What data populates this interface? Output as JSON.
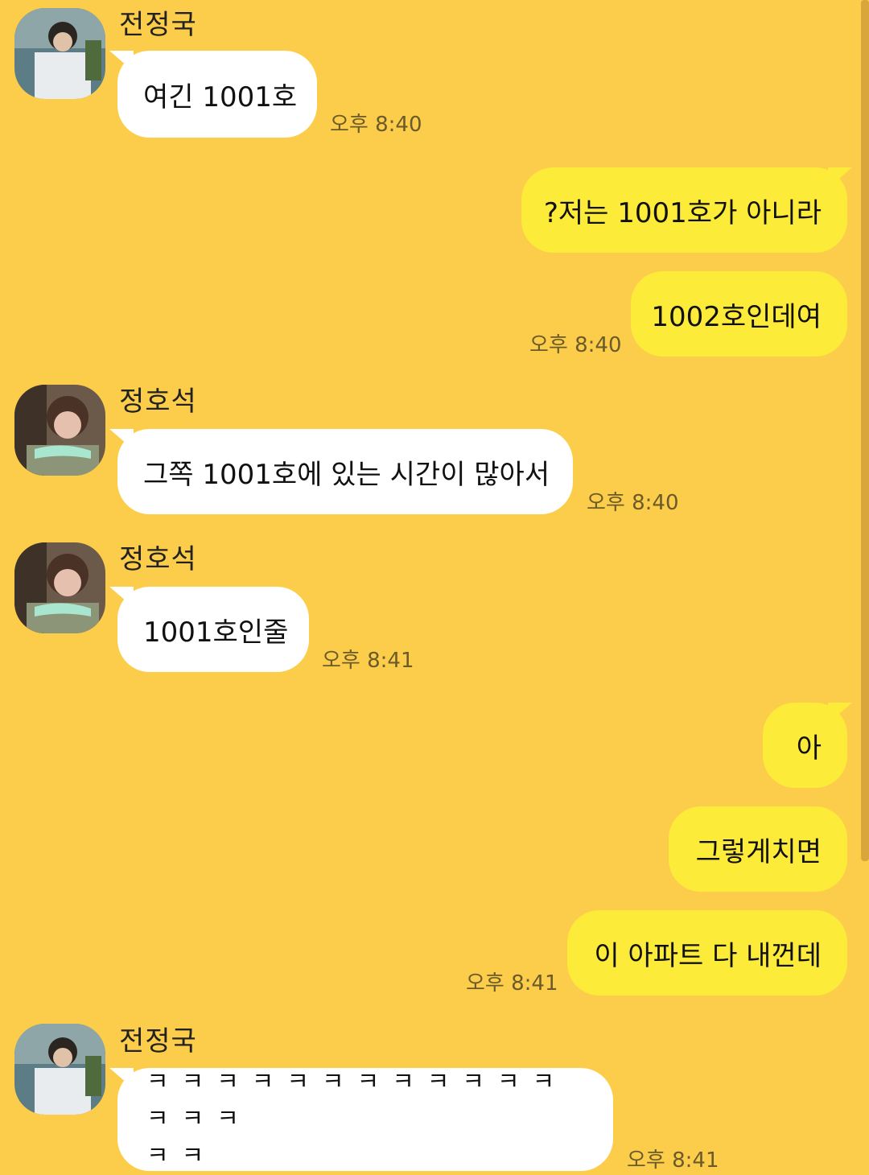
{
  "messages": [
    {
      "sender": "전정국",
      "text": "여긴 1001호",
      "time": "오후 8:40"
    },
    {
      "text": "?저는 1001호가 아니라"
    },
    {
      "text": "1002호인데여",
      "time": "오후 8:40"
    },
    {
      "sender": "정호석",
      "text": "그쪽 1001호에 있는 시간이 많아서",
      "time": "오후 8:40"
    },
    {
      "sender": "정호석",
      "text": "1001호인줄",
      "time": "오후 8:41"
    },
    {
      "text": "아"
    },
    {
      "text": "그렇게치면"
    },
    {
      "text": "이 아파트 다 내껀데",
      "time": "오후 8:41"
    },
    {
      "sender": "전정국",
      "text_line1": "ㅋㅋㅋㅋㅋㅋㅋㅋㅋㅋㅋㅋㅋㅋㅋ",
      "text_line2": "ㅋㅋ",
      "time": "오후 8:41"
    }
  ]
}
